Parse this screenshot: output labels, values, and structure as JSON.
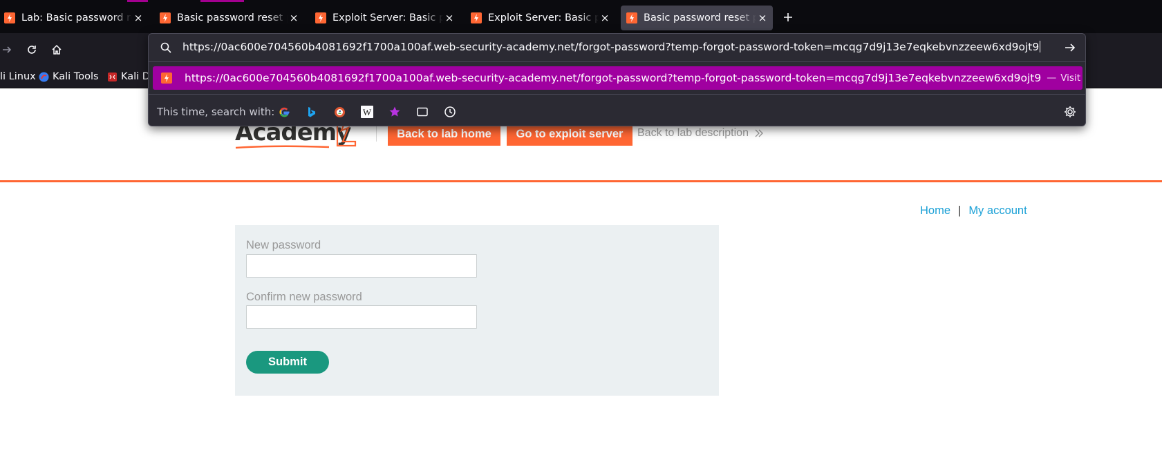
{
  "browser": {
    "tabs": [
      {
        "title": "Lab: Basic password reset poisoning",
        "active": false
      },
      {
        "title": "Basic password reset poisoning",
        "active": false
      },
      {
        "title": "Exploit Server: Basic password reset poisoning",
        "active": false
      },
      {
        "title": "Exploit Server: Basic password reset poisoning",
        "active": false
      },
      {
        "title": "Basic password reset poisoning",
        "active": true
      }
    ],
    "tab_close_glyph": "×",
    "new_tab_icon": "plus-icon",
    "nav_icons": [
      "forward-icon",
      "reload-icon",
      "home-icon"
    ],
    "bookmarks": [
      {
        "label": "li Linux",
        "icon": "kali-linux-icon"
      },
      {
        "label": "Kali Tools",
        "icon": "kali-tools-icon"
      },
      {
        "label": "Kali Do",
        "icon": "kali-docs-icon"
      }
    ],
    "urlbar": {
      "value": "https://0ac600e704560b4081692f1700a100af.web-security-academy.net/forgot-password?temp-forgot-password-token=mcqg7d9j13e7eqkebvnzzeew6xd9ojt9",
      "suggestion": {
        "url": "https://0ac600e704560b4081692f1700a100af.web-security-academy.net/forgot-password?temp-forgot-password-token=mcqg7d9j13e7eqkebvnzzeew6xd9ojt9",
        "separator": "—",
        "action": "Visit"
      },
      "search_with_label": "This time, search with:",
      "engines": [
        "google-icon",
        "bing-icon",
        "duckduckgo-icon",
        "wikipedia-icon",
        "bookmarks-star-icon",
        "tabs-icon",
        "history-icon"
      ]
    },
    "colors": {
      "tab_bg": "#0b0b0f",
      "toolbar_bg": "#1c1b22",
      "panel_bg": "#2b2a33",
      "highlight": "#a000a0"
    }
  },
  "lab_header": {
    "logo_text": "Academy",
    "back_to_lab_home": "Back to lab home",
    "go_to_exploit_server": "Go to exploit server",
    "back_to_lab_description": "Back to lab description",
    "colors": {
      "accent": "#ff6633"
    }
  },
  "top_links": {
    "home": "Home",
    "separator": "|",
    "my_account": "My account"
  },
  "form": {
    "new_password_label": "New password",
    "confirm_password_label": "Confirm new password",
    "new_password_value": "",
    "confirm_password_value": "",
    "submit_label": "Submit",
    "colors": {
      "submit_bg": "#1a987f",
      "panel_bg": "#ebf0f2"
    }
  }
}
